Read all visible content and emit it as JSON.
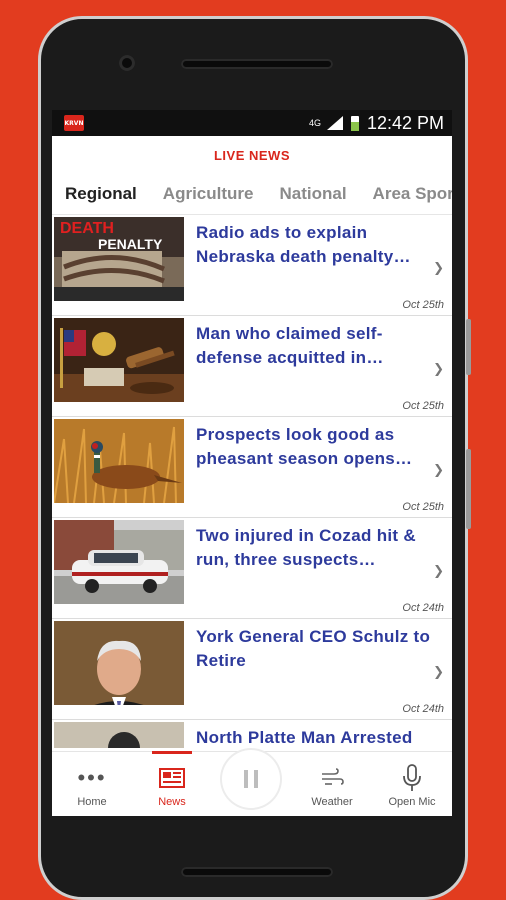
{
  "status": {
    "network": "4G",
    "time": "12:42 PM",
    "app_badge": "KRVN"
  },
  "header": {
    "title": "LIVE NEWS"
  },
  "tabs": [
    {
      "label": "Regional",
      "active": true
    },
    {
      "label": "Agriculture",
      "active": false
    },
    {
      "label": "National",
      "active": false
    },
    {
      "label": "Area Sports",
      "active": false
    }
  ],
  "news": [
    {
      "title": "Radio ads to explain Nebraska death penalty…",
      "date": "Oct 25th",
      "thumb": "death-penalty"
    },
    {
      "title": "Man who claimed self-defense acquitted in…",
      "date": "Oct 25th",
      "thumb": "gavel"
    },
    {
      "title": "Prospects look good as pheasant season opens…",
      "date": "Oct 25th",
      "thumb": "pheasant"
    },
    {
      "title": "Two injured in Cozad hit & run, three suspects…",
      "date": "Oct 24th",
      "thumb": "police-car"
    },
    {
      "title": "York General CEO Schulz to Retire",
      "date": "Oct 24th",
      "thumb": "portrait"
    },
    {
      "title": "North Platte Man Arrested",
      "date": "",
      "thumb": "partial"
    }
  ],
  "thumb_text": {
    "death_line1": "DEATH",
    "death_line2": "PENALTY"
  },
  "nav": {
    "home": "Home",
    "news": "News",
    "weather": "Weather",
    "open_mic": "Open Mic"
  },
  "colors": {
    "brand_red": "#d9261c",
    "headline_blue": "#2d3a9c",
    "background": "#e23c1f"
  }
}
